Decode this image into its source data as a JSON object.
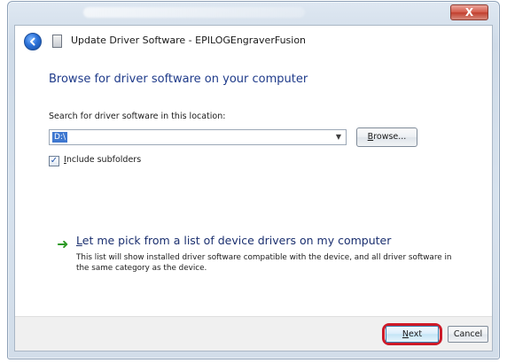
{
  "window": {
    "close_label": "X"
  },
  "header": {
    "title": "Update Driver Software - EPILOGEngraverFusion",
    "back_icon": "back-arrow-icon",
    "device_icon": "driver-document-icon"
  },
  "main": {
    "heading": "Browse for driver software on your computer",
    "search_label": "Search for driver software in this location:",
    "path_value": "D:\\",
    "browse_label": "Browse...",
    "include_subfolders_label": "Include subfolders",
    "include_subfolders_checked": true,
    "pick_link": "Let me pick from a list of device drivers on my computer",
    "pick_description": "This list will show installed driver software compatible with the device, and all driver software in the same category as the device."
  },
  "footer": {
    "next_label": "Next",
    "cancel_label": "Cancel"
  },
  "colors": {
    "heading": "#1f3b8a",
    "link_arrow": "#2d9a25",
    "highlight": "#ce1a28",
    "selection": "#3f78d0"
  }
}
